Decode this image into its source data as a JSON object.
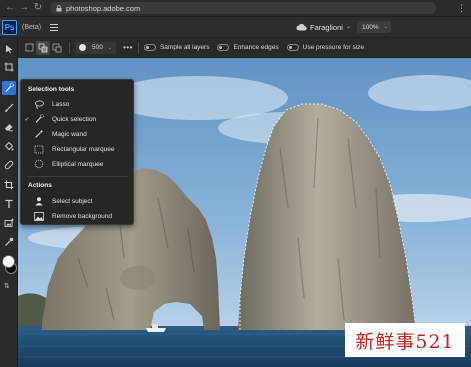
{
  "browser": {
    "url": "photoshop.adobe.com",
    "back_icon": "arrow-left-icon",
    "forward_icon": "arrow-right-icon",
    "reload_icon": "reload-icon"
  },
  "header": {
    "logo": "Ps",
    "beta": "(Beta)",
    "doc_name": "Faraglioni",
    "zoom": "100%"
  },
  "options": {
    "brush_size": "500",
    "more": "•••",
    "sample_all_layers": "Sample all layers",
    "enhance_edges": "Enhance edges",
    "use_pressure": "Use pressure for size"
  },
  "flyout": {
    "section_tools": "Selection tools",
    "tools": [
      {
        "label": "Lasso",
        "icon": "lasso-icon",
        "checked": false
      },
      {
        "label": "Quick selection",
        "icon": "quick-selection-icon",
        "checked": true
      },
      {
        "label": "Magic wand",
        "icon": "magic-wand-icon",
        "checked": false
      },
      {
        "label": "Rectangular marquee",
        "icon": "rectangular-marquee-icon",
        "checked": false
      },
      {
        "label": "Elliptical marquee",
        "icon": "elliptical-marquee-icon",
        "checked": false
      }
    ],
    "section_actions": "Actions",
    "actions": [
      {
        "label": "Select subject",
        "icon": "select-subject-icon"
      },
      {
        "label": "Remove background",
        "icon": "remove-background-icon"
      }
    ]
  },
  "watermark": "新鲜事521",
  "colors": {
    "accent": "#2c77d8",
    "ps_blue": "#31a8ff",
    "watermark_red": "#c81e1e"
  }
}
